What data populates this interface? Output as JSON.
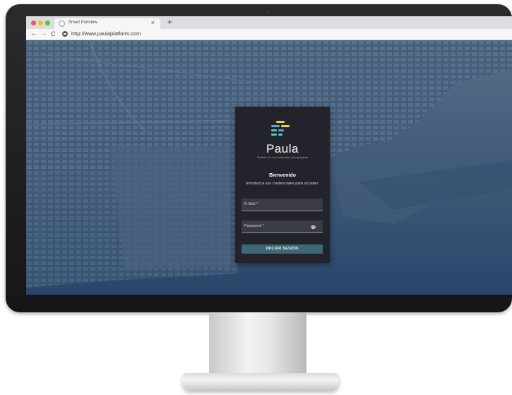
{
  "browser": {
    "tab_title": "Smart Portview",
    "tab_close": "×",
    "new_tab": "+",
    "back": "←",
    "forward": "→",
    "reload": "C",
    "url": "http://www.paulaplatform.com"
  },
  "login": {
    "brand": "Paula",
    "tagline": "Platform for Automatically Linking Agents",
    "welcome": "Bienvenido",
    "instructions": "Introduzca sus credenciales para acceder.",
    "email_label": "E-Mail *",
    "password_label": "Password *",
    "submit_label": "INICIAR SESIÓN"
  },
  "icons": {
    "traffic_lights": [
      "close-dot",
      "minimize-dot",
      "maximize-dot"
    ],
    "password_toggle": "eye-slash-icon"
  },
  "colors": {
    "card_background": "#23242b",
    "button": "#3e6874",
    "logo_bars": [
      "#f2d23c",
      "#f2d23c",
      "#5aa7de",
      "#f2d23c",
      "#5aa7de",
      "#57c4b6",
      "#57c4b6",
      "#57c4b6"
    ]
  }
}
